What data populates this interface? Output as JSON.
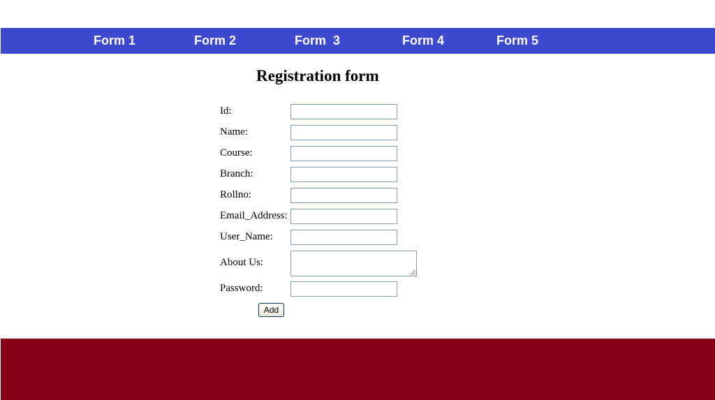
{
  "nav": {
    "items": [
      {
        "label": "Form 1"
      },
      {
        "label": "Form 2"
      },
      {
        "label": "Form  3"
      },
      {
        "label": "Form 4"
      },
      {
        "label": "Form 5"
      }
    ]
  },
  "form": {
    "title": "Registration form",
    "fields": {
      "id": {
        "label": "Id:",
        "value": ""
      },
      "name": {
        "label": "Name:",
        "value": ""
      },
      "course": {
        "label": "Course:",
        "value": ""
      },
      "branch": {
        "label": "Branch:",
        "value": ""
      },
      "rollno": {
        "label": "Rollno:",
        "value": ""
      },
      "email": {
        "label": "Email_Address:",
        "value": ""
      },
      "username": {
        "label": "User_Name:",
        "value": ""
      },
      "about": {
        "label": "About Us:",
        "value": ""
      },
      "password": {
        "label": "Password:",
        "value": ""
      }
    },
    "submit_label": "Add"
  },
  "colors": {
    "nav_background": "#3e49cf",
    "footer_background": "#870019",
    "input_border": "#7f9db9"
  }
}
